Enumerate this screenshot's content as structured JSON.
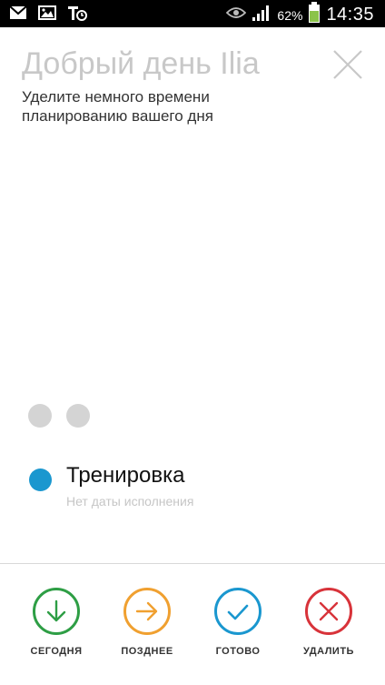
{
  "status_bar": {
    "battery_percent_label": "62%",
    "time": "14:35",
    "icons": [
      "mail-icon",
      "image-icon",
      "t-app-icon",
      "eye-icon",
      "signal-icon",
      "battery-icon"
    ]
  },
  "header": {
    "greeting": "Добрый день Ilia",
    "subtitle": "Уделите немного времени планированию вашего дня"
  },
  "pager": {
    "dot_count": 2
  },
  "task": {
    "title": "Тренировка",
    "due": "Нет даты исполнения",
    "color": "#1a97cf"
  },
  "actions": [
    {
      "label": "СЕГОДНЯ",
      "icon": "arrow-down-icon",
      "color": "#2e9e45"
    },
    {
      "label": "ПОЗДНЕЕ",
      "icon": "arrow-right-icon",
      "color": "#f0a030"
    },
    {
      "label": "ГОТОВО",
      "icon": "check-icon",
      "color": "#1a97cf"
    },
    {
      "label": "УДАЛИТЬ",
      "icon": "close-x-icon",
      "color": "#d8333a"
    }
  ]
}
